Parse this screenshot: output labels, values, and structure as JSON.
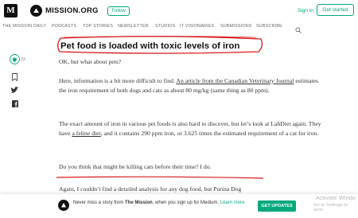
{
  "topbar": {
    "medium_logo": "M",
    "publication": "MISSION.ORG",
    "follow_label": "Follow",
    "signin_label": "Sign in",
    "get_started_label": "Get started"
  },
  "nav": {
    "items": [
      "THE MISSION DAILY",
      "PODCASTS",
      "TOP STORIES",
      "NEWSLETTER",
      "STUDIOS",
      "IT VISIONARIES",
      "SUBMISSIONS",
      "SUBSCRIBE"
    ],
    "search_icon": "search-icon"
  },
  "rail": {
    "clap_count": "32"
  },
  "article": {
    "heading": "Pet food is loaded with toxic levels of iron",
    "p1": "OK, but what about pets?",
    "p2_a": "Here, information is a bit more difficult to find. ",
    "p2_link": "An article from the Canadian Veterinary Journal",
    "p2_b": " estimates the iron requirement of both dogs and cats as about 80 mg/kg (same thing as 80 ppm).",
    "p3_a": "The exact amount of iron in various pet foods is also hard to discover, but let’s look at LabDiet again. They have ",
    "p3_link": "a feline diet",
    "p3_b": ", and it contains 290 ppm iron, or 3.625 times the estimated requirement of a cat for iron.",
    "p4": "Do you think that might be killing cats before their time? I do.",
    "p5": "Again, I couldn’t find a detailed analysis for any dog food, but Purina Dog"
  },
  "banner": {
    "text_a": "Never miss a story from ",
    "pub": "The Mission",
    "text_b": ", when you sign up for Medium. ",
    "learn_more": "Learn more",
    "button": "GET UPDATES"
  },
  "watermark": {
    "line1": "Activate Windo",
    "line2": "Go to Settings to activ"
  },
  "colors": {
    "accent": "#03a87c",
    "annotation": "#d7191c"
  }
}
